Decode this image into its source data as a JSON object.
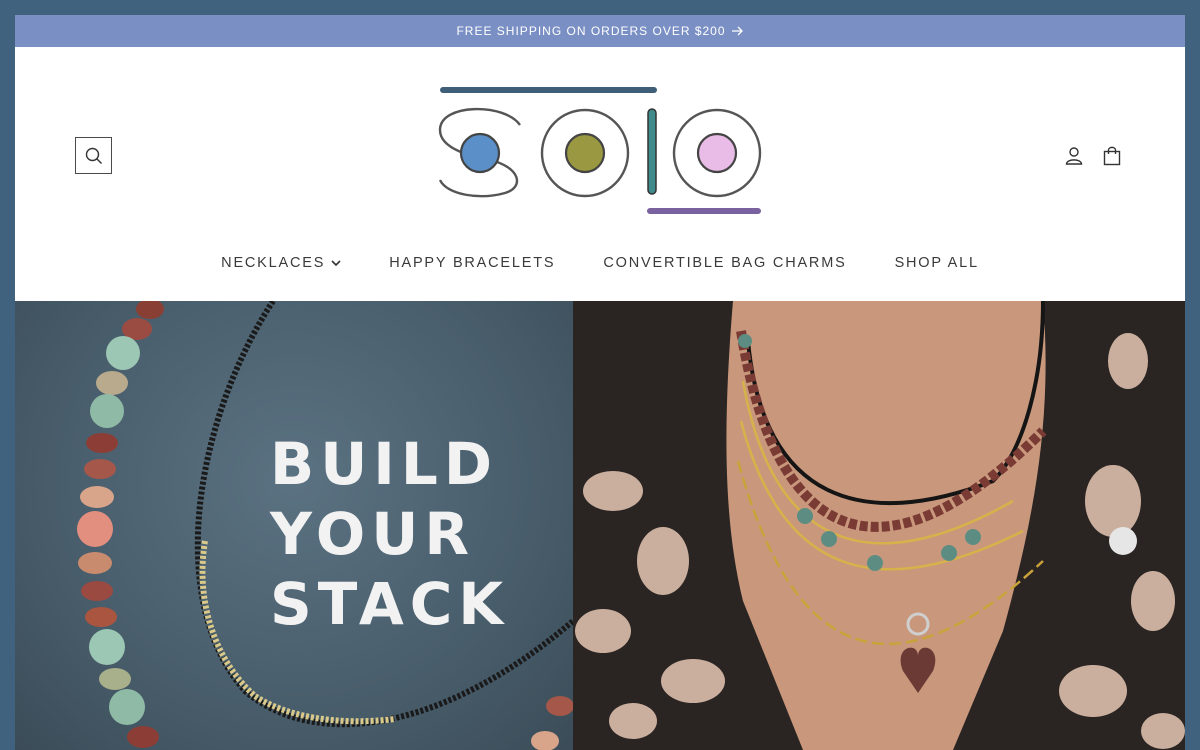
{
  "announcement": {
    "text": "FREE SHIPPING ON ORDERS OVER $200",
    "arrow_icon": "arrow-right-icon"
  },
  "header": {
    "logo_text": "solo",
    "search_icon": "search-icon",
    "account_icon": "user-icon",
    "cart_icon": "bag-icon"
  },
  "nav": {
    "items": [
      {
        "label": "NECKLACES",
        "has_dropdown": true
      },
      {
        "label": "HAPPY BRACELETS",
        "has_dropdown": false
      },
      {
        "label": "CONVERTIBLE BAG CHARMS",
        "has_dropdown": false
      },
      {
        "label": "SHOP ALL",
        "has_dropdown": false
      }
    ]
  },
  "hero": {
    "headline": [
      "BUILD",
      "YOUR",
      "STACK"
    ]
  },
  "colors": {
    "page_bg": "#41627f",
    "announcement_bg": "#7a8fc4",
    "logo_blue": "#5b8fc7",
    "logo_olive": "#9a9840",
    "logo_pink": "#e8bce6",
    "logo_teal": "#3f8b8b",
    "logo_purple": "#7a62a0"
  }
}
